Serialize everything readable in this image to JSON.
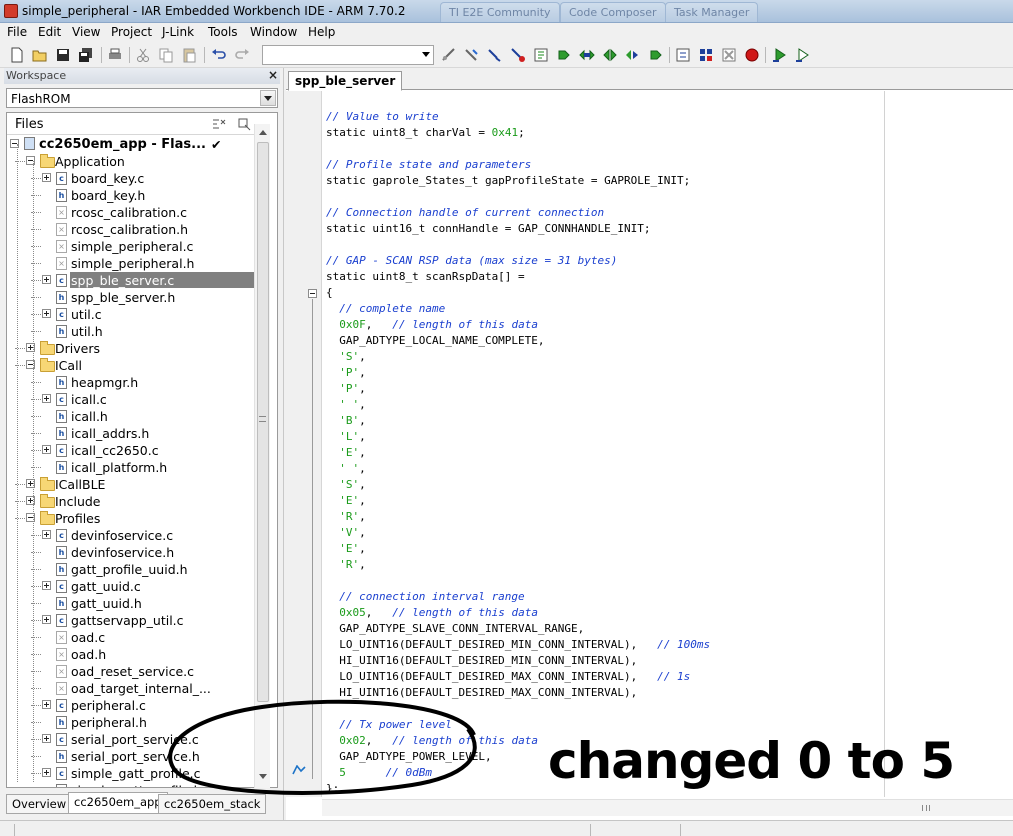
{
  "window": {
    "title": "simple_peripheral - IAR Embedded Workbench IDE - ARM 7.70.2",
    "background_tabs": [
      "TI E2E Community",
      "Code Composer",
      "Task Manager"
    ]
  },
  "menu": [
    "File",
    "Edit",
    "View",
    "Project",
    "J-Link",
    "Tools",
    "Window",
    "Help"
  ],
  "toolbar": {
    "icons": [
      "new-file-icon",
      "open-folder-icon",
      "save-icon",
      "save-all-icon",
      "print-icon",
      "cut-icon",
      "copy-icon",
      "paste-icon",
      "undo-icon",
      "redo-icon",
      "find-combo",
      "toggle-breakpoint-icon",
      "debug-icon",
      "compile-icon",
      "make-icon",
      "go-icon",
      "step-over-icon",
      "step-into-icon",
      "step-out-icon",
      "next-statement-icon",
      "build-icon",
      "rebuild-icon",
      "stop-build-icon",
      "breakpoint-icon",
      "download-debug-icon",
      "debug-without-download-icon"
    ],
    "search_value": ""
  },
  "workspace": {
    "header": "Workspace",
    "configuration": "FlashROM",
    "files_header": "Files",
    "project": "cc2650em_app - Flas...",
    "tree": [
      {
        "label": "cc2650em_app - Flas...",
        "type": "project",
        "depth": 0,
        "expander": "minus",
        "bold": true
      },
      {
        "label": "Application",
        "type": "folder",
        "depth": 1,
        "expander": "minus"
      },
      {
        "label": "board_key.c",
        "type": "c",
        "depth": 2,
        "expander": "plus"
      },
      {
        "label": "board_key.h",
        "type": "h",
        "depth": 2,
        "expander": "none"
      },
      {
        "label": "rcosc_calibration.c",
        "type": "excluded",
        "depth": 2,
        "expander": "none"
      },
      {
        "label": "rcosc_calibration.h",
        "type": "excluded",
        "depth": 2,
        "expander": "none"
      },
      {
        "label": "simple_peripheral.c",
        "type": "excluded",
        "depth": 2,
        "expander": "none"
      },
      {
        "label": "simple_peripheral.h",
        "type": "excluded",
        "depth": 2,
        "expander": "none"
      },
      {
        "label": "spp_ble_server.c",
        "type": "c",
        "depth": 2,
        "expander": "plus",
        "selected": true
      },
      {
        "label": "spp_ble_server.h",
        "type": "h",
        "depth": 2,
        "expander": "none"
      },
      {
        "label": "util.c",
        "type": "c",
        "depth": 2,
        "expander": "plus"
      },
      {
        "label": "util.h",
        "type": "h",
        "depth": 2,
        "expander": "none"
      },
      {
        "label": "Drivers",
        "type": "folder",
        "depth": 1,
        "expander": "plus"
      },
      {
        "label": "ICall",
        "type": "folder",
        "depth": 1,
        "expander": "minus"
      },
      {
        "label": "heapmgr.h",
        "type": "h",
        "depth": 2,
        "expander": "none"
      },
      {
        "label": "icall.c",
        "type": "c",
        "depth": 2,
        "expander": "plus"
      },
      {
        "label": "icall.h",
        "type": "h",
        "depth": 2,
        "expander": "none"
      },
      {
        "label": "icall_addrs.h",
        "type": "h",
        "depth": 2,
        "expander": "none"
      },
      {
        "label": "icall_cc2650.c",
        "type": "c",
        "depth": 2,
        "expander": "plus"
      },
      {
        "label": "icall_platform.h",
        "type": "h",
        "depth": 2,
        "expander": "none"
      },
      {
        "label": "ICallBLE",
        "type": "folder",
        "depth": 1,
        "expander": "plus"
      },
      {
        "label": "Include",
        "type": "folder",
        "depth": 1,
        "expander": "plus"
      },
      {
        "label": "Profiles",
        "type": "folder",
        "depth": 1,
        "expander": "minus"
      },
      {
        "label": "devinfoservice.c",
        "type": "c",
        "depth": 2,
        "expander": "plus"
      },
      {
        "label": "devinfoservice.h",
        "type": "h",
        "depth": 2,
        "expander": "none"
      },
      {
        "label": "gatt_profile_uuid.h",
        "type": "h",
        "depth": 2,
        "expander": "none"
      },
      {
        "label": "gatt_uuid.c",
        "type": "c",
        "depth": 2,
        "expander": "plus"
      },
      {
        "label": "gatt_uuid.h",
        "type": "h",
        "depth": 2,
        "expander": "none"
      },
      {
        "label": "gattservapp_util.c",
        "type": "c",
        "depth": 2,
        "expander": "plus"
      },
      {
        "label": "oad.c",
        "type": "excluded",
        "depth": 2,
        "expander": "none"
      },
      {
        "label": "oad.h",
        "type": "excluded",
        "depth": 2,
        "expander": "none"
      },
      {
        "label": "oad_reset_service.c",
        "type": "excluded",
        "depth": 2,
        "expander": "none"
      },
      {
        "label": "oad_target_internal_...",
        "type": "excluded",
        "depth": 2,
        "expander": "none"
      },
      {
        "label": "peripheral.c",
        "type": "c",
        "depth": 2,
        "expander": "plus"
      },
      {
        "label": "peripheral.h",
        "type": "h",
        "depth": 2,
        "expander": "none"
      },
      {
        "label": "serial_port_service.c",
        "type": "c",
        "depth": 2,
        "expander": "plus"
      },
      {
        "label": "serial_port_service.h",
        "type": "h",
        "depth": 2,
        "expander": "none"
      },
      {
        "label": "simple_gatt_profile.c",
        "type": "c",
        "depth": 2,
        "expander": "plus"
      },
      {
        "label": "simple_gatt_profile.h",
        "type": "h",
        "depth": 2,
        "expander": "none"
      }
    ],
    "tabs": [
      "Overview",
      "cc2650em_app",
      "cc2650em_stack"
    ],
    "active_tab": 1
  },
  "editor": {
    "tab": "spp_ble_server",
    "lines": [
      [
        [
          "cm",
          "// Value to write"
        ]
      ],
      [
        [
          "kw",
          "static uint8_t charVal = "
        ],
        [
          "nm",
          "0x41"
        ],
        [
          "kw",
          ";"
        ]
      ],
      [],
      [
        [
          "cm",
          "// Profile state and parameters"
        ]
      ],
      [
        [
          "kw",
          "static gaprole_States_t gapProfileState = GAPROLE_INIT;"
        ]
      ],
      [],
      [
        [
          "cm",
          "// Connection handle of current connection"
        ]
      ],
      [
        [
          "kw",
          "static uint16_t connHandle = GAP_CONNHANDLE_INIT;"
        ]
      ],
      [],
      [
        [
          "cm",
          "// GAP - SCAN RSP data (max size = 31 bytes)"
        ]
      ],
      [
        [
          "kw",
          "static uint8_t scanRspData[] ="
        ]
      ],
      [
        [
          "kw",
          "{"
        ]
      ],
      [
        [
          "cm",
          "  // complete name"
        ]
      ],
      [
        [
          "nm",
          "  0x0F"
        ],
        [
          "kw",
          ",   "
        ],
        [
          "cm",
          "// length of this data"
        ]
      ],
      [
        [
          "kw",
          "  GAP_ADTYPE_LOCAL_NAME_COMPLETE,"
        ]
      ],
      [
        [
          "nm",
          "  'S'"
        ],
        [
          "kw",
          ","
        ]
      ],
      [
        [
          "nm",
          "  'P'"
        ],
        [
          "kw",
          ","
        ]
      ],
      [
        [
          "nm",
          "  'P'"
        ],
        [
          "kw",
          ","
        ]
      ],
      [
        [
          "nm",
          "  ' '"
        ],
        [
          "kw",
          ","
        ]
      ],
      [
        [
          "nm",
          "  'B'"
        ],
        [
          "kw",
          ","
        ]
      ],
      [
        [
          "nm",
          "  'L'"
        ],
        [
          "kw",
          ","
        ]
      ],
      [
        [
          "nm",
          "  'E'"
        ],
        [
          "kw",
          ","
        ]
      ],
      [
        [
          "nm",
          "  ' '"
        ],
        [
          "kw",
          ","
        ]
      ],
      [
        [
          "nm",
          "  'S'"
        ],
        [
          "kw",
          ","
        ]
      ],
      [
        [
          "nm",
          "  'E'"
        ],
        [
          "kw",
          ","
        ]
      ],
      [
        [
          "nm",
          "  'R'"
        ],
        [
          "kw",
          ","
        ]
      ],
      [
        [
          "nm",
          "  'V'"
        ],
        [
          "kw",
          ","
        ]
      ],
      [
        [
          "nm",
          "  'E'"
        ],
        [
          "kw",
          ","
        ]
      ],
      [
        [
          "nm",
          "  'R'"
        ],
        [
          "kw",
          ","
        ]
      ],
      [],
      [
        [
          "cm",
          "  // connection interval range"
        ]
      ],
      [
        [
          "nm",
          "  0x05"
        ],
        [
          "kw",
          ",   "
        ],
        [
          "cm",
          "// length of this data"
        ]
      ],
      [
        [
          "kw",
          "  GAP_ADTYPE_SLAVE_CONN_INTERVAL_RANGE,"
        ]
      ],
      [
        [
          "kw",
          "  LO_UINT16(DEFAULT_DESIRED_MIN_CONN_INTERVAL),   "
        ],
        [
          "cm",
          "// 100ms"
        ]
      ],
      [
        [
          "kw",
          "  HI_UINT16(DEFAULT_DESIRED_MIN_CONN_INTERVAL),"
        ]
      ],
      [
        [
          "kw",
          "  LO_UINT16(DEFAULT_DESIRED_MAX_CONN_INTERVAL),   "
        ],
        [
          "cm",
          "// 1s"
        ]
      ],
      [
        [
          "kw",
          "  HI_UINT16(DEFAULT_DESIRED_MAX_CONN_INTERVAL),"
        ]
      ],
      [],
      [
        [
          "cm",
          "  // Tx power level"
        ]
      ],
      [
        [
          "nm",
          "  0x02"
        ],
        [
          "kw",
          ",   "
        ],
        [
          "cm",
          "// length of this data"
        ]
      ],
      [
        [
          "kw",
          "  GAP_ADTYPE_POWER_LEVEL,"
        ]
      ],
      [
        [
          "nm",
          "  5"
        ],
        [
          "kw",
          "      "
        ],
        [
          "cm",
          "// 0dBm"
        ]
      ],
      [
        [
          "kw",
          "};"
        ]
      ]
    ]
  },
  "annotation": {
    "text": "changed 0 to 5"
  }
}
